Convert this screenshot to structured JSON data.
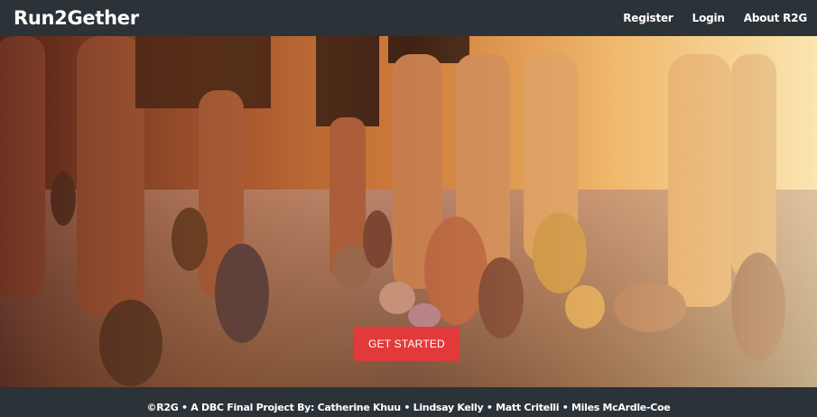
{
  "navbar": {
    "brand": "Run2Gether",
    "links": [
      {
        "label": "Register"
      },
      {
        "label": "Login"
      },
      {
        "label": "About R2G"
      }
    ]
  },
  "hero": {
    "image_description_icon": "runners-legs-photo",
    "cta_label": "GET STARTED"
  },
  "footer": {
    "text": "©R2G • A DBC Final Project By: Catherine Khuu • Lindsay Kelly • Matt Critelli • Miles McArdle-Coe"
  },
  "colors": {
    "navbar_bg": "#2b3238",
    "cta_bg": "#e23a3a",
    "text": "#ffffff"
  }
}
